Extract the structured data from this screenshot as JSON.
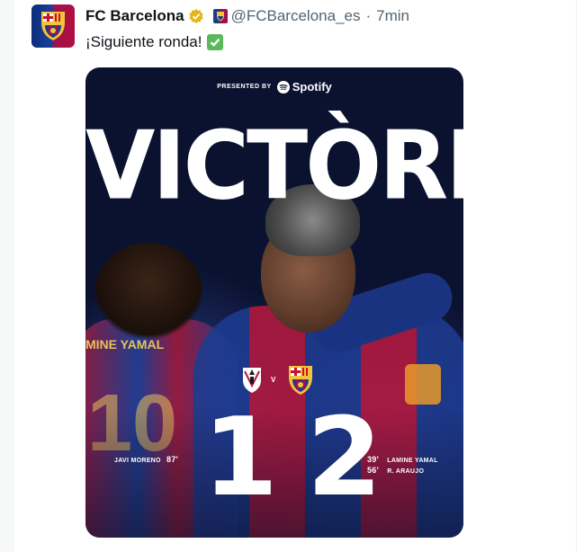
{
  "tweet": {
    "display_name": "FC Barcelona",
    "handle": "@FCBarcelona_es",
    "separator": "·",
    "time": "7min",
    "text": "¡Siguiente ronda!"
  },
  "media": {
    "presented_by": "PRESENTED BY",
    "sponsor": "Spotify",
    "headline": "VICTÒRIA",
    "shirt_name": "MINE YAMAL",
    "shirt_number": "10",
    "vs": "V",
    "home_score": "1",
    "away_score": "2",
    "home_scorers": [
      {
        "name": "JAVI MORENO",
        "minute": "87'"
      }
    ],
    "away_scorers": [
      {
        "minute": "39'",
        "name": "LAMINE YAMAL"
      },
      {
        "minute": "56'",
        "name": "R. ARAUJO"
      }
    ]
  },
  "icons": {
    "verified": "verified-gold-badge-icon",
    "affiliate": "fc-barcelona-affiliate-icon",
    "check": "white-check-mark-emoji"
  },
  "colors": {
    "text_primary": "#0f1419",
    "text_secondary": "#536471",
    "verified_gold": "#e2b719",
    "barca_blue": "#1c3b90",
    "barca_red": "#b3183e"
  }
}
